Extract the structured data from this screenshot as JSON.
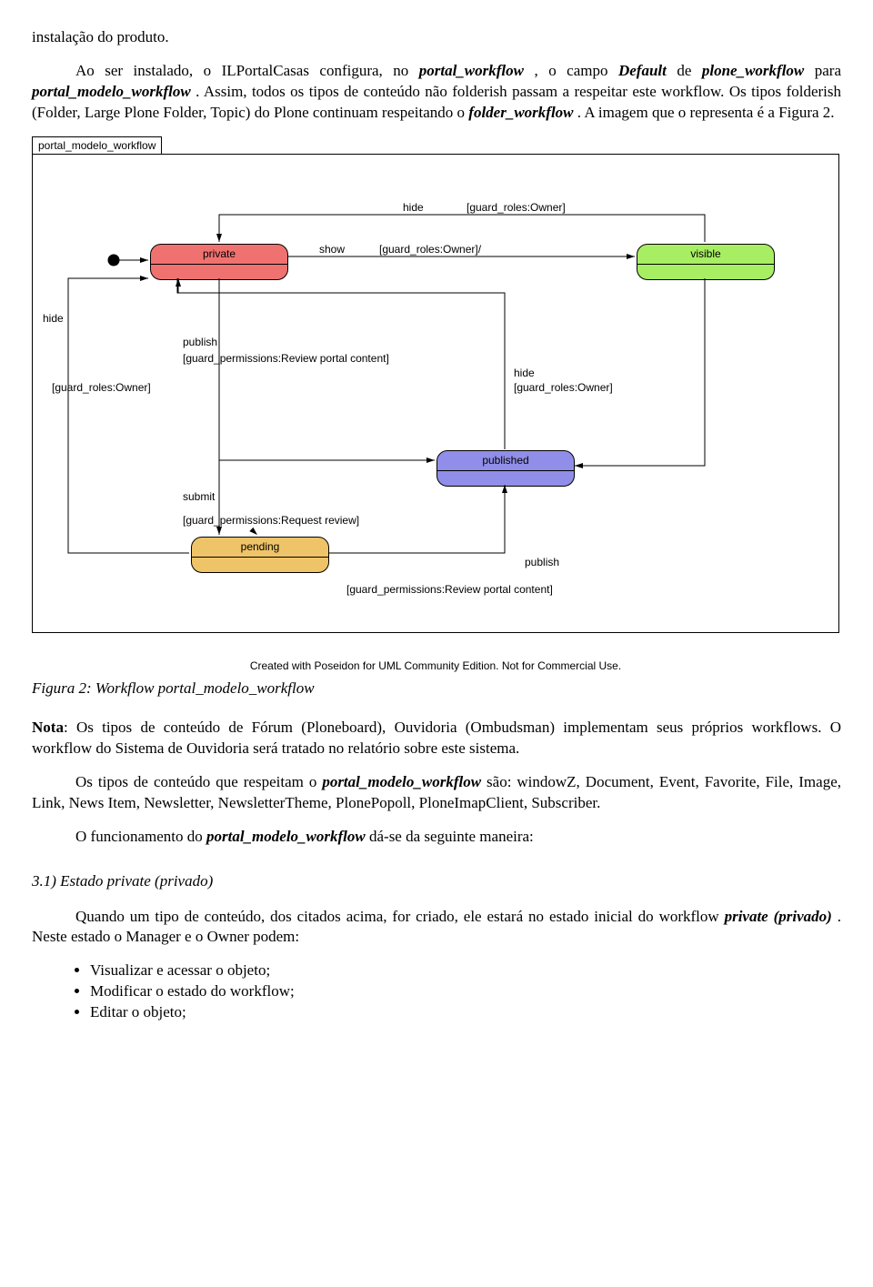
{
  "p1a": "instalação do produto.",
  "p2": {
    "t1": "Ao ser instalado, o ILPortalCasas configura, no ",
    "i1": "portal_workflow",
    "t2": ", o campo ",
    "i2": "Default",
    "t3": " de ",
    "i3": "plone_workflow",
    "t4": " para ",
    "i4": "portal_modelo_workflow",
    "t5": ". Assim, todos os tipos de conteúdo não folderish passam a respeitar este workflow. Os tipos folderish (Folder, Large Plone Folder, Topic) do Plone continuam respeitando o ",
    "i5": "folder_workflow",
    "t6": ". A imagem que o representa é a Figura 2."
  },
  "diagram": {
    "frame_name": "portal_modelo_workflow",
    "states": {
      "private": "private",
      "visible": "visible",
      "published": "published",
      "pending": "pending"
    },
    "lbl_hide1": "hide",
    "lbl_guard_owner1": "[guard_roles:Owner]",
    "lbl_show": "show",
    "lbl_guard_owner2": "[guard_roles:Owner]/",
    "lbl_hide2": "hide",
    "lbl_publish1": "publish",
    "lbl_guard_review1": "[guard_permissions:Review portal content]",
    "lbl_guard_owner3": "[guard_roles:Owner]",
    "lbl_hide3": "hide",
    "lbl_guard_owner4": "[guard_roles:Owner]",
    "lbl_submit": "submit",
    "lbl_guard_request": "[guard_permissions:Request review]",
    "lbl_publish2": "publish",
    "lbl_guard_review2": "[guard_permissions:Review portal content]",
    "credit": "Created with Poseidon for UML Community Edition. Not for Commercial Use."
  },
  "caption": "Figura 2: Workflow portal_modelo_workflow",
  "p3": {
    "b1": "Nota",
    "t1": ": Os tipos de conteúdo de Fórum (Ploneboard), Ouvidoria (Ombudsman) implementam seus próprios workflows. O workflow do Sistema de Ouvidoria será tratado no relatório sobre este sistema."
  },
  "p4": {
    "t1": "Os tipos de conteúdo que respeitam o ",
    "bi1": "portal_modelo_workflow",
    "t2": " são: windowZ, Document, Event, Favorite, File, Image, Link, News Item, Newsletter, NewsletterTheme, PlonePopoll, PloneImapClient, Subscriber."
  },
  "p5": {
    "t1": "O funcionamento do ",
    "bi1": "portal_modelo_workflow",
    "t2": " dá-se da seguinte maneira:"
  },
  "sec31": "3.1) Estado private (privado)",
  "p6": {
    "t1": "Quando um tipo de conteúdo, dos citados acima, for criado, ele estará no estado inicial do workflow ",
    "bi1": "private (privado)",
    "t2": ". Neste estado o Manager e o Owner podem:"
  },
  "bullets": {
    "b1": "Visualizar e acessar o objeto;",
    "b2": "Modificar o estado do workflow;",
    "b3": "Editar o objeto;"
  }
}
